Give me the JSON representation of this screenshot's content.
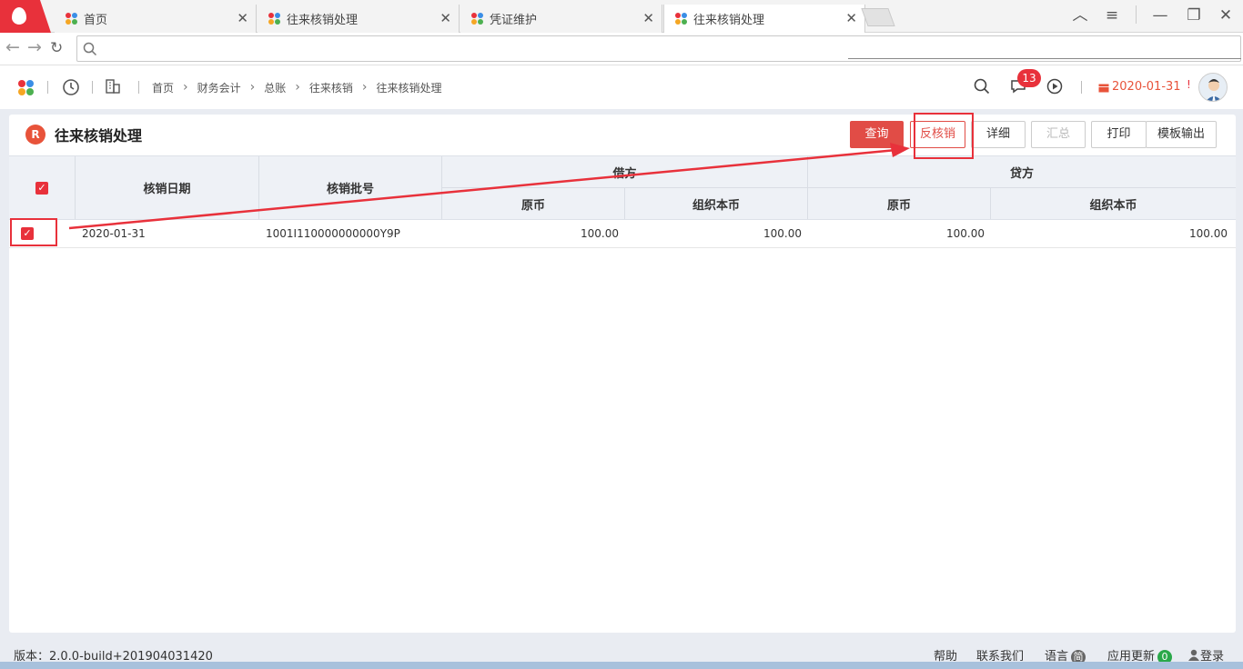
{
  "browser": {
    "tabs": [
      {
        "label": "首页",
        "active": false
      },
      {
        "label": "往来核销处理",
        "active": false
      },
      {
        "label": "凭证维护",
        "active": false
      },
      {
        "label": "往来核销处理",
        "active": true
      }
    ],
    "close_glyph": "✕",
    "window_controls": {
      "minimize": "—",
      "restore": "❐",
      "close": "✕",
      "menu": "≡",
      "up": "︿"
    }
  },
  "header": {
    "breadcrumb": [
      "首页",
      "财务会计",
      "总账",
      "往来核销",
      "往来核销处理"
    ],
    "breadcrumb_sep": "›",
    "message_count": "13",
    "date": "2020-01-31",
    "alert_mark": "!"
  },
  "page": {
    "title": "往来核销处理",
    "title_icon": "R",
    "buttons": {
      "query": "查询",
      "unverify": "反核销",
      "detail": "详细",
      "summary": "汇总",
      "print": "打印",
      "template_export": "模板输出"
    }
  },
  "table": {
    "headers": {
      "date": "核销日期",
      "batch": "核销批号",
      "debit": "借方",
      "credit": "贷方",
      "original": "原币",
      "org_currency": "组织本币"
    },
    "rows": [
      {
        "checked": true,
        "date": "2020-01-31",
        "batch": "1001I110000000000Y9P",
        "debit_original": "100.00",
        "debit_org": "100.00",
        "credit_original": "100.00",
        "credit_org": "100.00"
      }
    ],
    "header_checked": true
  },
  "status": {
    "version": "版本：2.0.0-build+201904031420",
    "help": "帮助",
    "contact": "联系我们",
    "language": "语言",
    "language_badge": "简",
    "updates": "应用更新",
    "updates_count": "0",
    "login": "登录"
  },
  "colors": {
    "accent_red": "#e8313b",
    "primary_btn": "#e14c46",
    "date_orange": "#e8533a",
    "update_badge_green": "#2aa84a"
  }
}
